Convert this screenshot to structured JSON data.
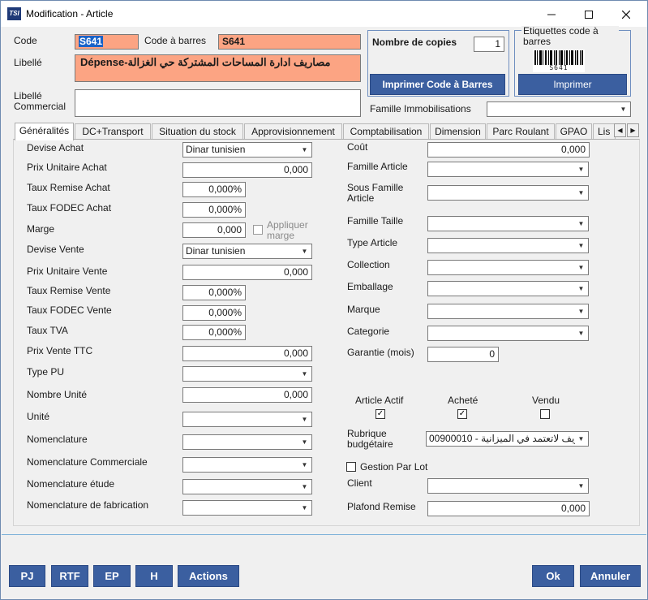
{
  "window": {
    "app_icon": "TSI",
    "title": "Modification - Article",
    "minimize_icon": "minimize-icon",
    "maximize_icon": "maximize-icon",
    "close_icon": "close-icon"
  },
  "header": {
    "code_label": "Code",
    "code_value": "S641",
    "barcode_label": "Code à barres",
    "barcode_value": "S641",
    "libelle_label": "Libellé",
    "libelle_value": "مصاريف ادارة المساحات المشتركة حي الغزالة-Dépense",
    "libelle_commercial_label": "Libellé Commercial",
    "libelle_commercial_value": "",
    "copies_label": "Nombre de copies",
    "copies_value": "1",
    "print_barcode_button": "Imprimer Code à Barres",
    "etiquettes_label": "Etiquettes code à barres",
    "barcode_caption": "S641",
    "print_button": "Imprimer",
    "famille_immo_label": "Famille Immobilisations",
    "famille_immo_value": ""
  },
  "tabs": [
    {
      "label": "Généralités",
      "active": true
    },
    {
      "label": "DC+Transport"
    },
    {
      "label": "Situation du stock"
    },
    {
      "label": "Approvisionnement"
    },
    {
      "label": "Comptabilisation"
    },
    {
      "label": "Dimension"
    },
    {
      "label": "Parc Roulant"
    },
    {
      "label": "GPAO"
    },
    {
      "label": "Lis"
    }
  ],
  "left": {
    "devise_achat_label": "Devise Achat",
    "devise_achat_value": "Dinar tunisien",
    "prix_unitaire_achat_label": "Prix Unitaire Achat",
    "prix_unitaire_achat_value": "0,000",
    "taux_remise_achat_label": "Taux Remise Achat",
    "taux_remise_achat_value": "0,000%",
    "taux_fodec_achat_label": "Taux FODEC Achat",
    "taux_fodec_achat_value": "0,000%",
    "marge_label": "Marge",
    "marge_value": "0,000",
    "appliquer_marge_label": "Appliquer marge",
    "devise_vente_label": "Devise Vente",
    "devise_vente_value": "Dinar tunisien",
    "prix_unitaire_vente_label": "Prix Unitaire Vente",
    "prix_unitaire_vente_value": "0,000",
    "taux_remise_vente_label": "Taux Remise Vente",
    "taux_remise_vente_value": "0,000%",
    "taux_fodec_vente_label": "Taux FODEC Vente",
    "taux_fodec_vente_value": "0,000%",
    "taux_tva_label": "Taux TVA",
    "taux_tva_value": "0,000%",
    "prix_vente_ttc_label": "Prix Vente TTC",
    "prix_vente_ttc_value": "0,000",
    "type_pu_label": "Type PU",
    "nombre_unite_label": "Nombre Unité",
    "nombre_unite_value": "0,000",
    "unite_label": "Unité",
    "nomenclature_label": "Nomenclature",
    "nomenclature_commerciale_label": "Nomenclature Commerciale",
    "nomenclature_etude_label": "Nomenclature étude",
    "nomenclature_fabrication_label": "Nomenclature de fabrication"
  },
  "right": {
    "cout_label": "Coût",
    "cout_value": "0,000",
    "famille_article_label": "Famille Article",
    "sous_famille_label": "Sous Famille Article",
    "famille_taille_label": "Famille Taille",
    "type_article_label": "Type Article",
    "collection_label": "Collection",
    "emballage_label": "Emballage",
    "marque_label": "Marque",
    "categorie_label": "Categorie",
    "garantie_label": "Garantie (mois)",
    "garantie_value": "0",
    "article_actif_label": "Article Actif",
    "article_actif_checked": true,
    "achete_label": "Acheté",
    "achete_checked": true,
    "vendu_label": "Vendu",
    "vendu_checked": false,
    "rubrique_label": "Rubrique budgétaire",
    "rubrique_value": "00900010 - ريف لاتعتمد في الميزانية",
    "gestion_lot_label": "Gestion Par Lot",
    "client_label": "Client",
    "plafond_remise_label": "Plafond Remise",
    "plafond_remise_value": "0,000"
  },
  "footer": {
    "pj": "PJ",
    "rtf": "RTF",
    "ep": "EP",
    "h": "H",
    "actions": "Actions",
    "ok": "Ok",
    "annuler": "Annuler"
  },
  "check_mark": "✓"
}
